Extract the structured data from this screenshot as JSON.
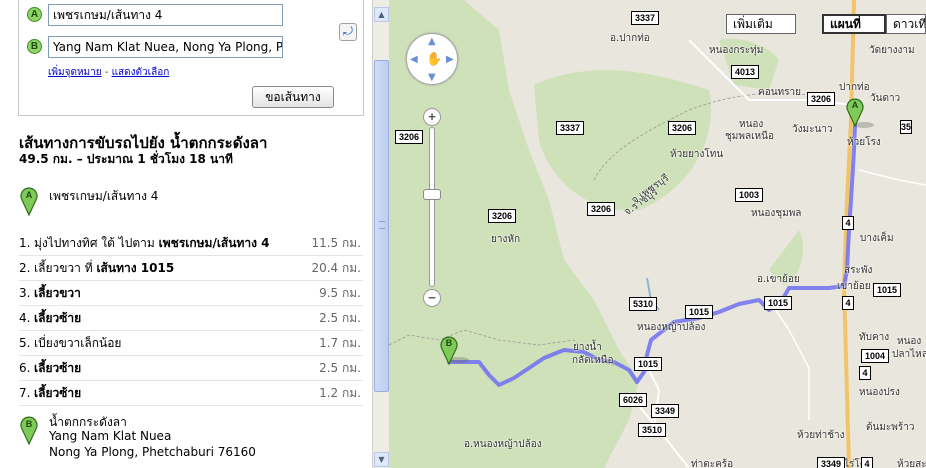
{
  "form": {
    "waypoint_a_marker": "A",
    "waypoint_a_value": "เพชรเกษม/เส้นทาง 4",
    "waypoint_b_marker": "B",
    "waypoint_b_value": "Yang Nam Klat Nuea, Nong Ya Plong, P",
    "swap_icon": "swap-icon",
    "add_destination": "เพิ่มจุดหมาย",
    "separator": "-",
    "show_options": "แสดงตัวเลือก",
    "get_directions": "ขอเส้นทาง"
  },
  "route": {
    "title": "เส้นทางการขับรถไปยัง น้ำตกกระดังลา",
    "summary": "49.5 กม. – ประมาณ 1 ชั่วโมง 18 นาที",
    "start_marker": "A",
    "start_label": "เพชรเกษม/เส้นทาง 4",
    "steps": [
      {
        "num": "1.",
        "text": "มุ่งไปทางทิศ ใต้ ไปตาม ",
        "bold": "เพชรเกษม/เส้นทาง 4",
        "dist": "11.5 กม."
      },
      {
        "num": "2.",
        "text": "เลี้ยวขวา ที่ ",
        "bold": "เส้นทาง 1015",
        "dist": "20.4 กม."
      },
      {
        "num": "3.",
        "text": "",
        "bold": "เลี้ยวขวา",
        "dist": "9.5 กม."
      },
      {
        "num": "4.",
        "text": "",
        "bold": "เลี้ยวซ้าย",
        "dist": "2.5 กม."
      },
      {
        "num": "5.",
        "text": "เบี่ยงขวาเล็กน้อย",
        "bold": "",
        "dist": "1.7 กม."
      },
      {
        "num": "6.",
        "text": "",
        "bold": "เลี้ยวซ้าย",
        "dist": "2.5 กม."
      },
      {
        "num": "7.",
        "text": "",
        "bold": "เลี้ยวซ้าย",
        "dist": "1.2 กม."
      }
    ],
    "end_marker": "B",
    "end_name": "น้ำตกกระดังลา",
    "end_line1": "Yang Nam Klat Nuea",
    "end_line2": "Nong Ya Plong, Phetchaburi 76160"
  },
  "map": {
    "type_buttons": [
      "เพิ่มเติม",
      "แผนที่",
      "ดาวเทียม"
    ],
    "active_type": "แผนที่",
    "zoom_in": "+",
    "zoom_out": "−",
    "places": [
      "อ.ปากท่อ",
      "หนองกระทุ่ม",
      "วัดยางงาม",
      "คอนทราย",
      "ปากท่อ",
      "วันดาว",
      "หนอง",
      "ชุมพลเหนือ",
      "วังมะนาว",
      "ห้วยโรง",
      "ห้วยยางโทน",
      "จ.ราชบุรี",
      "จ.เพชรบุรี",
      "ยางหัก",
      "หนองชุมพล",
      "บางเค็ม",
      "สระพัง",
      "อ.เขาย้อย",
      "เขาย้อย",
      "ยางน้ำ",
      "กลัดเหนือ",
      "หนองหญ้าปล้อง",
      "ทับคาง",
      "หนอง",
      "ปลาไหล",
      "หนองปรง",
      "ห้วยท่าช้าง",
      "ต้นมะพร้าว",
      "อ.หนองหญ้าปล้อง",
      "ท่าตะคร้อ",
      "ไร่โคก",
      "ห้วยสะ"
    ],
    "shields": [
      "3337",
      "4013",
      "3206",
      "35",
      "3337",
      "3206",
      "3206",
      "1003",
      "3206",
      "3206",
      "4",
      "1015",
      "5310",
      "1015",
      "1015",
      "4",
      "1015",
      "6026",
      "3349",
      "3510",
      "1004",
      "4",
      "3349",
      "4"
    ]
  }
}
